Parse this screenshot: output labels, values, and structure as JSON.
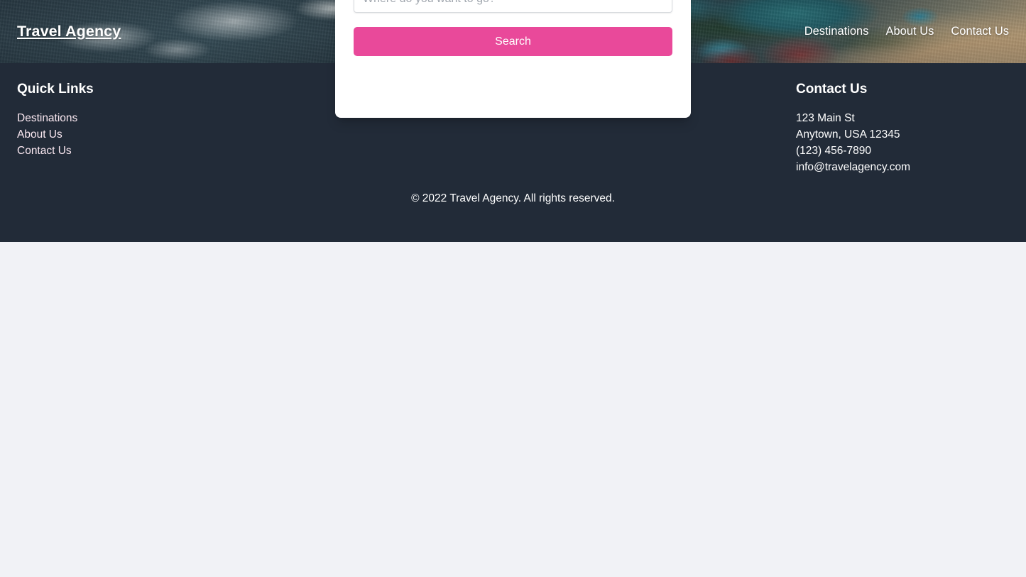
{
  "site": {
    "brand": "Travel Agency",
    "accent_color": "#e9499a",
    "footer_bg": "#222b38",
    "page_bg": "#f1f2f6"
  },
  "nav": {
    "links": [
      {
        "label": "Destinations"
      },
      {
        "label": "About Us"
      },
      {
        "label": "Contact Us"
      }
    ]
  },
  "search": {
    "placeholder": "Where do you want to go?",
    "value": "",
    "button_label": "Search"
  },
  "footer": {
    "quick_links": {
      "heading": "Quick Links",
      "items": [
        {
          "label": "Destinations"
        },
        {
          "label": "About Us"
        },
        {
          "label": "Contact Us"
        }
      ]
    },
    "contact": {
      "heading": "Contact Us",
      "address_line1": "123 Main St",
      "address_line2": "Anytown, USA 12345",
      "phone": "(123) 456-7890",
      "email": "info@travelagency.com"
    },
    "copyright": "© 2022 Travel Agency. All rights reserved."
  }
}
